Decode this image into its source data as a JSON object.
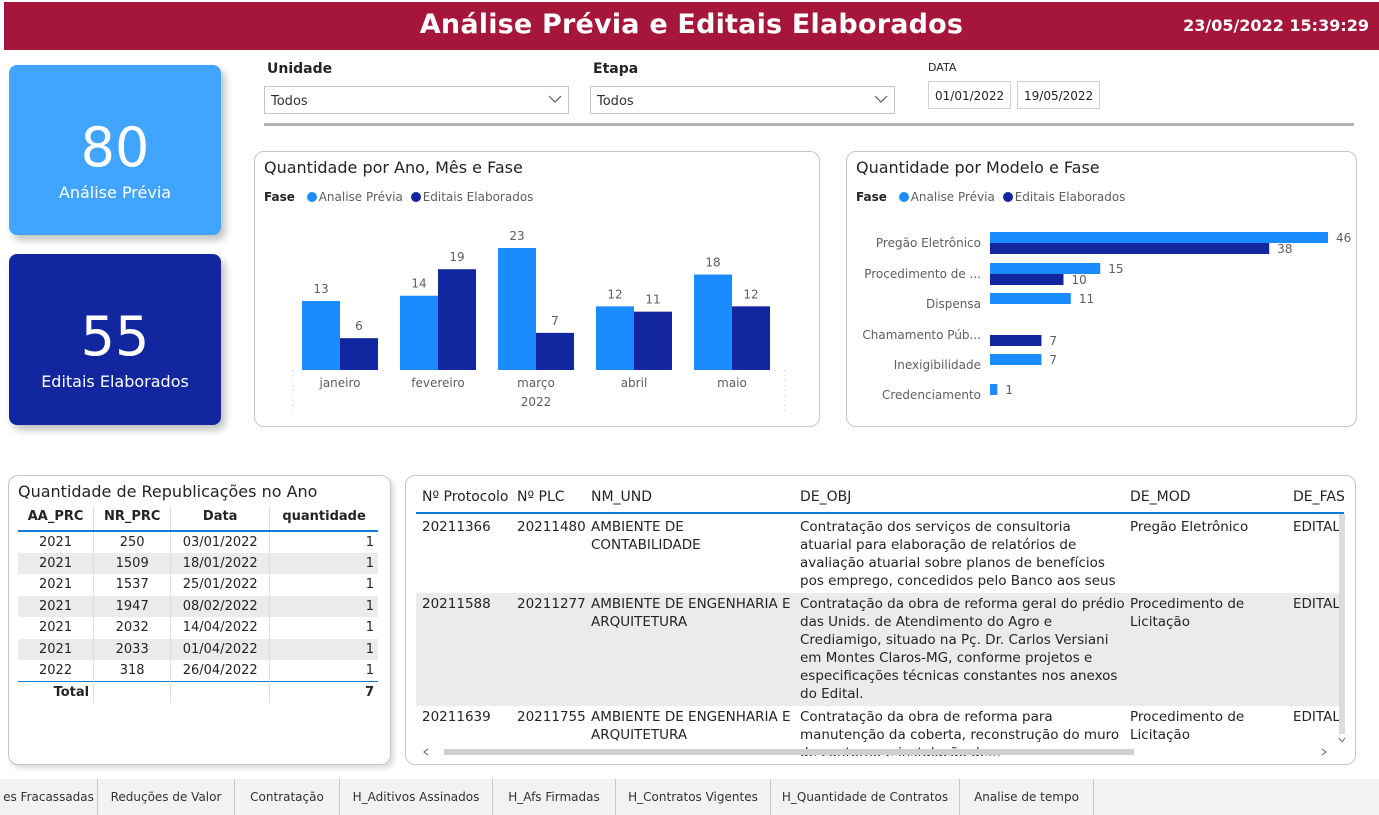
{
  "header": {
    "title": "Análise Prévia e Editais Elaborados",
    "timestamp": "23/05/2022 15:39:29"
  },
  "colors": {
    "header": "#a6163a",
    "analise": "#1b8cff",
    "editais": "#1226a0",
    "accent": "#0e7ad9"
  },
  "kpis": [
    {
      "value": "80",
      "label": "Análise Prévia"
    },
    {
      "value": "55",
      "label": "Editais Elaborados"
    }
  ],
  "filters": {
    "unidade": {
      "label": "Unidade",
      "value": "Todos"
    },
    "etapa": {
      "label": "Etapa",
      "value": "Todos"
    },
    "data": {
      "label": "DATA",
      "start": "01/01/2022",
      "end": "19/05/2022"
    }
  },
  "chart_data": [
    {
      "type": "bar",
      "title": "Quantidade por Ano, Mês e Fase",
      "legend_title": "Fase",
      "categories": [
        "janeiro",
        "fevereiro",
        "março",
        "abril",
        "maio"
      ],
      "year_label": "2022",
      "series": [
        {
          "name": "Analise Prévia",
          "values": [
            13,
            14,
            23,
            12,
            18
          ]
        },
        {
          "name": "Editais Elaborados",
          "values": [
            6,
            19,
            7,
            11,
            12
          ]
        }
      ],
      "ylim": [
        0,
        23
      ]
    },
    {
      "type": "bar",
      "orientation": "horizontal",
      "title": "Quantidade por Modelo e Fase",
      "legend_title": "Fase",
      "categories": [
        "Pregão Eletrônico",
        "Procedimento de ...",
        "Dispensa",
        "Chamamento Púb...",
        "Inexigibilidade",
        "Credenciamento"
      ],
      "series": [
        {
          "name": "Analise Prévia",
          "values": [
            46,
            15,
            11,
            null,
            7,
            1
          ]
        },
        {
          "name": "Editais Elaborados",
          "values": [
            38,
            10,
            null,
            7,
            null,
            null
          ]
        }
      ],
      "xlim": [
        0,
        46
      ]
    }
  ],
  "republicacoes": {
    "title": "Quantidade de Republicações no Ano",
    "columns": [
      "AA_PRC",
      "NR_PRC",
      "Data",
      "quantidade"
    ],
    "rows": [
      [
        "2021",
        "250",
        "03/01/2022",
        "1"
      ],
      [
        "2021",
        "1509",
        "18/01/2022",
        "1"
      ],
      [
        "2021",
        "1537",
        "25/01/2022",
        "1"
      ],
      [
        "2021",
        "1947",
        "08/02/2022",
        "1"
      ],
      [
        "2021",
        "2032",
        "14/04/2022",
        "1"
      ],
      [
        "2021",
        "2033",
        "01/04/2022",
        "1"
      ],
      [
        "2022",
        "318",
        "26/04/2022",
        "1"
      ]
    ],
    "total_label": "Total",
    "total_value": "7"
  },
  "detalhe": {
    "columns": [
      "Nº Protocolo",
      "Nº PLC",
      "NM_UND",
      "DE_OBJ",
      "DE_MOD",
      "DE_FAS"
    ],
    "rows": [
      [
        "20211366",
        "20211480",
        "AMBIENTE DE CONTABILIDADE",
        "Contratação dos serviços de consultoria atuarial para elaboração de relatórios de avaliação atuarial sobre planos de benefícios pos emprego, concedidos pelo Banco aos seus empregados.",
        "Pregão Eletrônico",
        "EDITAL"
      ],
      [
        "20211588",
        "20211277",
        "AMBIENTE DE ENGENHARIA E ARQUITETURA",
        "Contratação da obra de reforma geral do prédio das Unids. de Atendimento do Agro e Crediamigo, situado na Pç. Dr. Carlos Versiani em Montes Claros-MG, conforme projetos e especificações técnicas constantes nos anexos do Edital.",
        "Procedimento de Licitação",
        "EDITAL"
      ],
      [
        "20211639",
        "20211755",
        "AMBIENTE DE ENGENHARIA E ARQUITETURA",
        "Contratação da obra de reforma para manutenção da coberta, reconstrução do muro de contorno e instalação de...",
        "Procedimento de Licitação",
        "EDITAL"
      ]
    ]
  },
  "tabs": [
    "es Fracassadas",
    "Reduções de Valor",
    "Contratação",
    "H_Aditivos Assinados",
    "H_Afs Firmadas",
    "H_Contratos Vigentes",
    "H_Quantidade de Contratos",
    "Analise de tempo"
  ]
}
